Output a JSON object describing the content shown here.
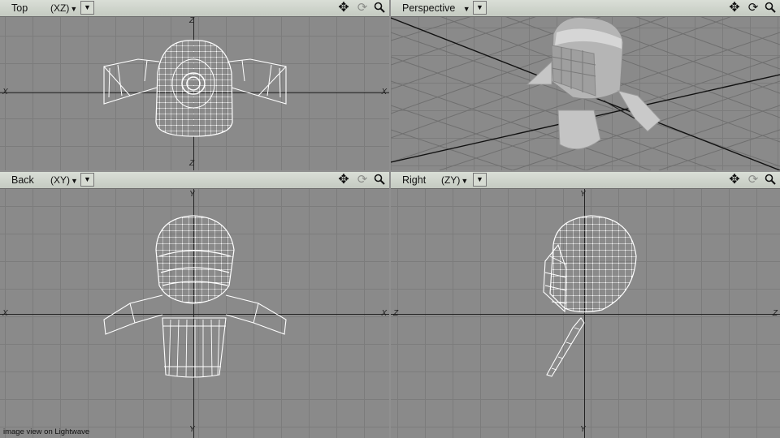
{
  "viewports": {
    "top": {
      "name": "Top",
      "axis": "(XZ)",
      "axis_labels": {
        "left": "X",
        "right": "X",
        "top": "Z",
        "bottom": "Z"
      }
    },
    "persp": {
      "name": "Perspective",
      "axis": ""
    },
    "back": {
      "name": "Back",
      "axis": "(XY)",
      "axis_labels": {
        "left": "X",
        "right": "X",
        "top": "Y",
        "bottom": "Y"
      }
    },
    "right": {
      "name": "Right",
      "axis": "(ZY)",
      "axis_labels": {
        "left": "Z",
        "right": "Z",
        "top": "Y",
        "bottom": "Y"
      }
    }
  },
  "icons": {
    "dropdown": "triangle-down",
    "move": "four-way-arrow",
    "rotate": "rotate-arrows",
    "zoom": "magnifier"
  },
  "caption": "image view on Lightwave",
  "colors": {
    "viewport_bg": "#8a8a8a",
    "grid": "#7c7c7c",
    "header": "#cfd4cc",
    "wire": "#ffffff"
  }
}
